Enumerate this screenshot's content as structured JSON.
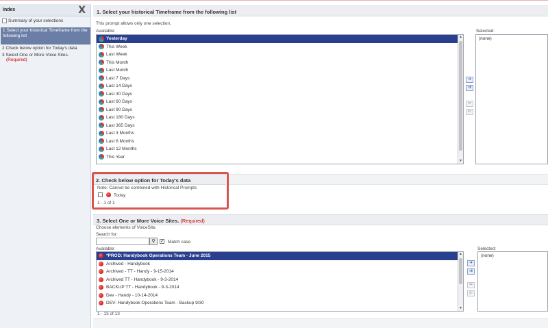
{
  "index": {
    "title": "Index",
    "close": "X",
    "summary": "Summary of your selections",
    "items": [
      {
        "num": "1",
        "label": "Select your historical Timeframe from the following list"
      },
      {
        "num": "2",
        "label": "Check below option for Today's data"
      },
      {
        "num": "3",
        "label": "Select One or More Voice Sites.",
        "req": "(Required)"
      }
    ]
  },
  "section1": {
    "title": "1.  Select your historical Timeframe from the following list",
    "note": "This prompt allows only one selection.",
    "available_label": "Available:",
    "selected_label": "Selected:",
    "selected_value": "(none)",
    "items": [
      "Yesterday",
      "This Week",
      "Last  Week",
      "This Month",
      "Last Month",
      "Last 7 Days",
      "Last 14 Days",
      "Last 30 Days",
      "Last 60 Days",
      "Last 90 Days",
      "Last 180 Days",
      "Last 365 Days",
      "Last 3 Months",
      "Last 6 Months",
      "Last 12 Months",
      "This Year"
    ]
  },
  "section2": {
    "title": "2.   Check below option for Today's data",
    "note": "Note: Cannot be combined with Historical Prompts",
    "option": "Today",
    "count": "1 - 1 of 1"
  },
  "section3": {
    "title": "3.  Select One or More Voice Sites.",
    "req": "(Required)",
    "note": "Choose elements of VoiceSite.",
    "search_label": "Search for:",
    "search_value": "",
    "match_case": "Match case",
    "available_label": "Available:",
    "selected_label": "Selected:",
    "selected_value": "(none)",
    "items": [
      "*PROD: Handybook Operations Team - June 2015",
      "Archived - Handybook",
      "Archived - TT - Handy - 9-15-2014",
      "Archived TT - Handybook - 9-3-2014",
      "BACKUP TT - Handybook - 9-3-2014",
      "Dev - Handy - 10-14-2014",
      "DEV: Handybook Operations Team - Backup 9/30"
    ],
    "count": "1 - 13 of 13"
  },
  "arrows": {
    "add": "➔",
    "add_all": "⇉",
    "remove": "⬅",
    "remove_all": "⇇"
  }
}
